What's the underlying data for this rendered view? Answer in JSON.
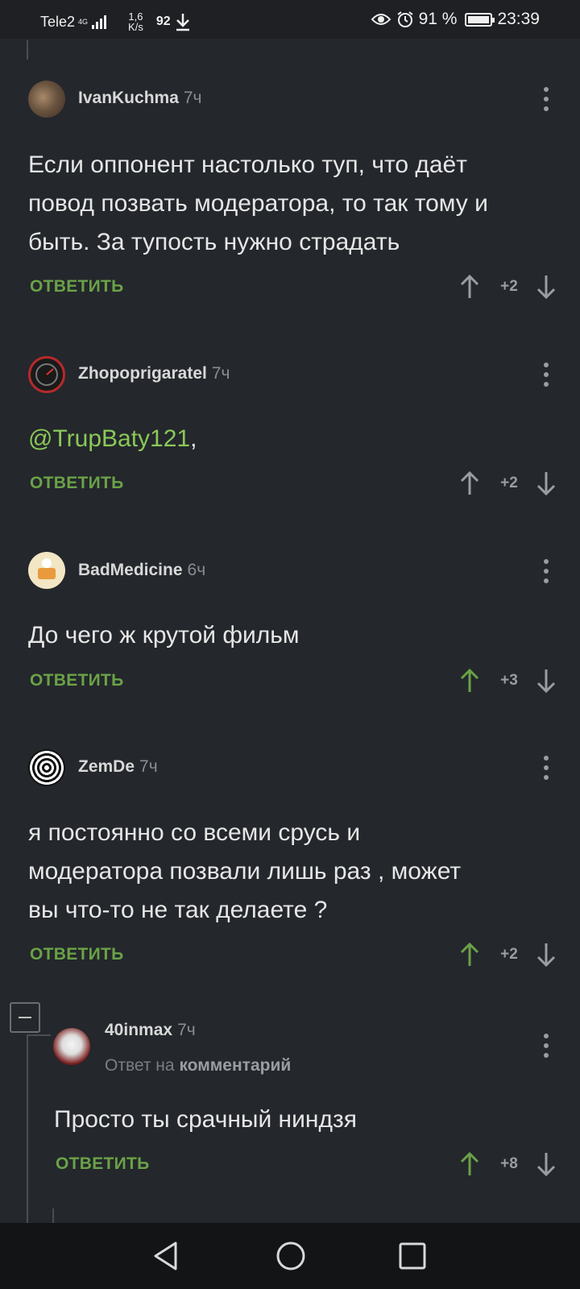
{
  "status": {
    "carrier": "Tele2",
    "net_top": "4G",
    "net_bottom": "",
    "speed_top": "1,6",
    "speed_bottom": "K/s",
    "extra": "92",
    "battery": "91 %",
    "time": "23:39"
  },
  "comments": [
    {
      "author": "IvanKuchma",
      "time": "7ч",
      "text_lines": [
        "Если оппонент настолько туп, что даёт",
        "повод позвать модератора, то так тому и",
        "быть. За тупость нужно страдать"
      ],
      "reply_label": "ОТВЕТИТЬ",
      "score": "+2",
      "upvoted": false
    },
    {
      "author": "Zhopoprigaratel",
      "time": "7ч",
      "mention": "@TrupBaty121",
      "after_mention": ",",
      "reply_label": "ОТВЕТИТЬ",
      "score": "+2",
      "upvoted": false
    },
    {
      "author": "BadMedicine",
      "time": "6ч",
      "text_lines": [
        "До чего ж крутой фильм"
      ],
      "reply_label": "ОТВЕТИТЬ",
      "score": "+3",
      "upvoted": true
    },
    {
      "author": "ZemDe",
      "time": "7ч",
      "text_lines": [
        "я постоянно со всеми срусь и",
        "модератора позвали лишь раз , может",
        "вы что-то не так делаете ?"
      ],
      "reply_label": "ОТВЕТИТЬ",
      "score": "+2",
      "upvoted": true
    },
    {
      "author": "40inmax",
      "time": "7ч",
      "reply_to_prefix": "Ответ на",
      "reply_to_link": "комментарий",
      "text_lines": [
        "Просто ты срачный ниндзя"
      ],
      "reply_label": "ОТВЕТИТЬ",
      "score": "+8",
      "upvoted": true
    }
  ],
  "colors": {
    "background": "#24272c",
    "accent_green": "#6aa247",
    "mention": "#8ac858",
    "muted": "#8a8d92"
  }
}
